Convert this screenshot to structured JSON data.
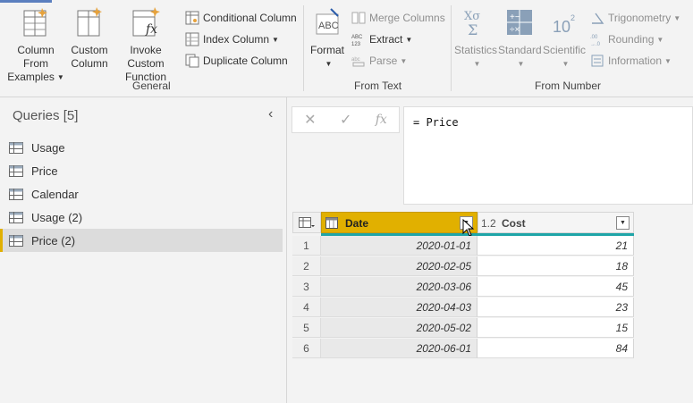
{
  "ribbon": {
    "general": {
      "label": "General",
      "column_from_examples": [
        "Column From",
        "Examples"
      ],
      "custom_column": [
        "Custom",
        "Column"
      ],
      "invoke_custom_function": [
        "Invoke Custom",
        "Function"
      ],
      "conditional_column": "Conditional Column",
      "index_column": "Index Column",
      "duplicate_column": "Duplicate Column"
    },
    "from_text": {
      "label": "From Text",
      "format": "Format",
      "merge_columns": "Merge Columns",
      "extract": "Extract",
      "parse": "Parse"
    },
    "from_number": {
      "label": "From Number",
      "statistics": "Statistics",
      "standard": "Standard",
      "scientific": "Scientific",
      "trigonometry": "Trigonometry",
      "rounding": "Rounding",
      "information": "Information"
    }
  },
  "queries": {
    "header": "Queries [5]",
    "items": [
      {
        "label": "Usage"
      },
      {
        "label": "Price"
      },
      {
        "label": "Calendar"
      },
      {
        "label": "Usage (2)"
      },
      {
        "label": "Price (2)"
      }
    ],
    "selected": "Price (2)"
  },
  "formula_bar": {
    "cancel": "✕",
    "commit": "✓",
    "fx": "fx",
    "formula": "= Price"
  },
  "table": {
    "columns": [
      {
        "type_label": "",
        "name": "Date"
      },
      {
        "type_label": "1.2",
        "name": "Cost"
      }
    ],
    "rows": [
      {
        "num": "1",
        "date": "2020-01-01",
        "cost": "21"
      },
      {
        "num": "2",
        "date": "2020-02-05",
        "cost": "18"
      },
      {
        "num": "3",
        "date": "2020-03-06",
        "cost": "45"
      },
      {
        "num": "4",
        "date": "2020-04-03",
        "cost": "23"
      },
      {
        "num": "5",
        "date": "2020-05-02",
        "cost": "15"
      },
      {
        "num": "6",
        "date": "2020-06-01",
        "cost": "84"
      }
    ]
  },
  "colors": {
    "selected_header": "#e1b000",
    "quality_bar": "#1fa5a8",
    "ribbon_accent": "#5b7fbf"
  }
}
